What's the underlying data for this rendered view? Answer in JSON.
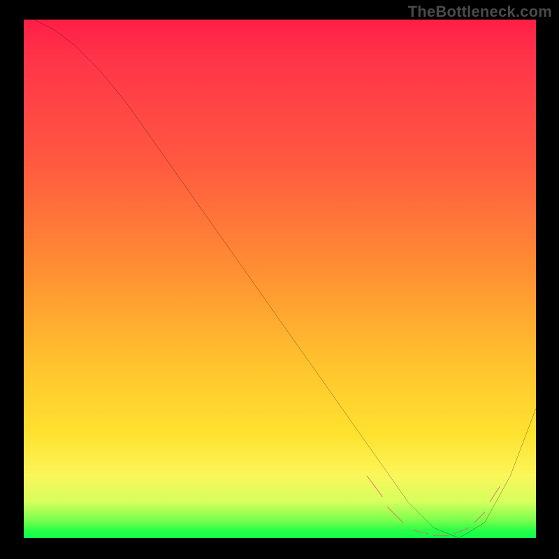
{
  "watermark": "TheBottleneck.com",
  "chart_data": {
    "type": "line",
    "title": "",
    "xlabel": "",
    "ylabel": "",
    "xlim": [
      0,
      100
    ],
    "ylim": [
      0,
      100
    ],
    "legend": false,
    "grid": false,
    "background_gradient_stops": [
      {
        "pos": 0.0,
        "color": "#ff1f46"
      },
      {
        "pos": 0.28,
        "color": "#ff5a40"
      },
      {
        "pos": 0.48,
        "color": "#ff8e33"
      },
      {
        "pos": 0.66,
        "color": "#ffc22e"
      },
      {
        "pos": 0.8,
        "color": "#ffe22f"
      },
      {
        "pos": 0.88,
        "color": "#fbf65a"
      },
      {
        "pos": 0.93,
        "color": "#d6ff5e"
      },
      {
        "pos": 0.965,
        "color": "#7cff4d"
      },
      {
        "pos": 0.985,
        "color": "#2bff47"
      },
      {
        "pos": 1.0,
        "color": "#0cff4b"
      }
    ],
    "series": [
      {
        "name": "main-curve",
        "color": "#000000",
        "stroke_width": 2,
        "x": [
          2,
          6,
          10,
          15,
          20,
          25,
          30,
          35,
          40,
          45,
          50,
          55,
          60,
          65,
          70,
          75,
          80,
          85,
          90,
          95,
          100
        ],
        "y": [
          100,
          98,
          95,
          90,
          84,
          77,
          70,
          63,
          56,
          49,
          42,
          35,
          28,
          21,
          14,
          7,
          2,
          0,
          3,
          12,
          25
        ]
      },
      {
        "name": "highlight-dashes",
        "color": "#e06a6a",
        "stroke_width": 6,
        "segments": [
          {
            "x": [
              67,
              70
            ],
            "y": [
              12,
              8
            ]
          },
          {
            "x": [
              71,
              74
            ],
            "y": [
              6,
              3
            ]
          },
          {
            "x": [
              76,
              79
            ],
            "y": [
              1.5,
              0.8
            ]
          },
          {
            "x": [
              80,
              83
            ],
            "y": [
              0.5,
              0.5
            ]
          },
          {
            "x": [
              84,
              87
            ],
            "y": [
              0.8,
              2
            ]
          },
          {
            "x": [
              88,
              90
            ],
            "y": [
              3,
              5
            ]
          },
          {
            "x": [
              91,
              93
            ],
            "y": [
              7,
              10
            ]
          }
        ]
      }
    ],
    "annotations": []
  }
}
